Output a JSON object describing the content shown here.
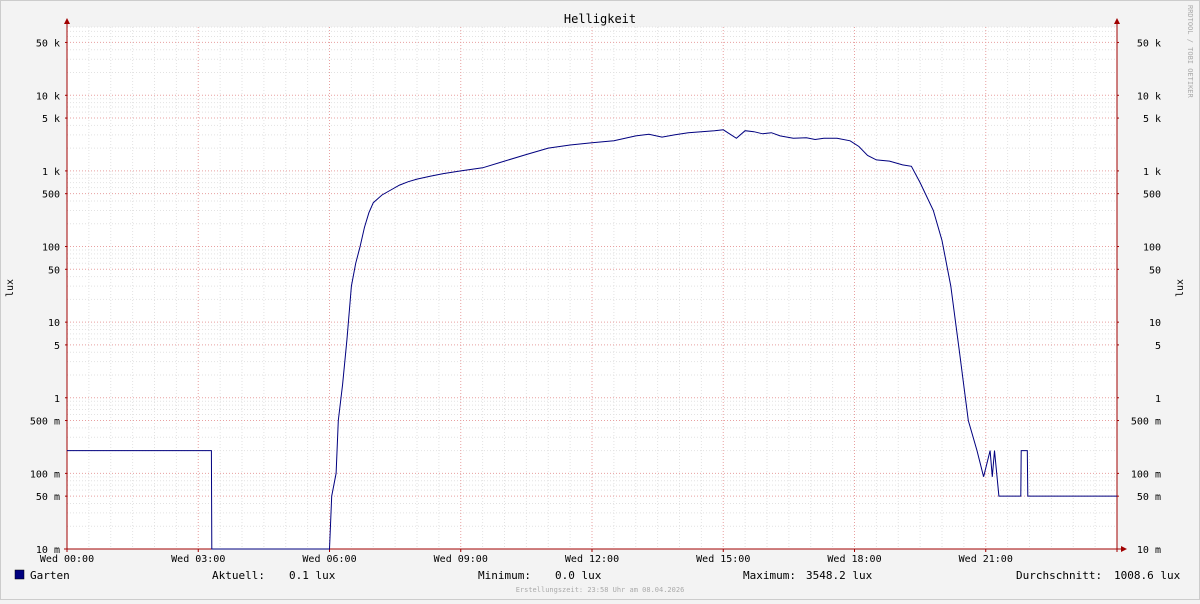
{
  "chart_data": {
    "type": "line",
    "title": "Helligkeit",
    "ylabel": "lux",
    "yscale": "log",
    "ylim": [
      0.01,
      80000
    ],
    "xlim": [
      0,
      24
    ],
    "x_ticks": [
      {
        "x": 0,
        "label": "Wed 00:00"
      },
      {
        "x": 3,
        "label": "Wed 03:00"
      },
      {
        "x": 6,
        "label": "Wed 06:00"
      },
      {
        "x": 9,
        "label": "Wed 09:00"
      },
      {
        "x": 12,
        "label": "Wed 12:00"
      },
      {
        "x": 15,
        "label": "Wed 15:00"
      },
      {
        "x": 18,
        "label": "Wed 18:00"
      },
      {
        "x": 21,
        "label": "Wed 21:00"
      }
    ],
    "y_ticks": [
      {
        "y": 0.01,
        "label": "10 m"
      },
      {
        "y": 0.05,
        "label": "50 m"
      },
      {
        "y": 0.1,
        "label": "100 m"
      },
      {
        "y": 0.5,
        "label": "500 m"
      },
      {
        "y": 1,
        "label": "1"
      },
      {
        "y": 5,
        "label": "5"
      },
      {
        "y": 10,
        "label": "10"
      },
      {
        "y": 50,
        "label": "50"
      },
      {
        "y": 100,
        "label": "100"
      },
      {
        "y": 500,
        "label": "500"
      },
      {
        "y": 1000,
        "label": "1 k"
      },
      {
        "y": 5000,
        "label": "5 k"
      },
      {
        "y": 10000,
        "label": "10 k"
      },
      {
        "y": 50000,
        "label": "50 k"
      }
    ],
    "grid": true,
    "series": [
      {
        "name": "Garten",
        "color": "#00007f",
        "x": [
          0,
          3.3,
          3.31,
          6.0,
          6.05,
          6.15,
          6.2,
          6.3,
          6.4,
          6.5,
          6.6,
          6.7,
          6.8,
          6.9,
          7.0,
          7.2,
          7.4,
          7.6,
          7.8,
          8.0,
          8.3,
          8.6,
          9.0,
          9.5,
          10.0,
          10.5,
          11.0,
          11.5,
          12.0,
          12.5,
          13.0,
          13.3,
          13.6,
          13.9,
          14.2,
          14.5,
          14.8,
          15.0,
          15.3,
          15.5,
          15.7,
          15.9,
          16.1,
          16.3,
          16.6,
          16.9,
          17.1,
          17.3,
          17.6,
          17.9,
          18.1,
          18.3,
          18.5,
          18.8,
          19.1,
          19.3,
          19.5,
          19.8,
          20.0,
          20.2,
          20.4,
          20.6,
          20.8,
          20.95,
          21.1,
          21.15,
          21.2,
          21.3,
          21.31,
          21.8,
          21.81,
          21.95,
          21.96,
          22.1,
          22.11,
          24.0
        ],
        "values": [
          0.2,
          0.2,
          0.01,
          0.01,
          0.05,
          0.1,
          0.5,
          1.5,
          6,
          30,
          60,
          100,
          180,
          280,
          380,
          480,
          560,
          650,
          720,
          780,
          850,
          920,
          1000,
          1100,
          1350,
          1650,
          2000,
          2200,
          2350,
          2500,
          2900,
          3050,
          2800,
          3000,
          3200,
          3300,
          3400,
          3500,
          2700,
          3400,
          3300,
          3100,
          3200,
          2900,
          2700,
          2750,
          2600,
          2700,
          2700,
          2500,
          2100,
          1600,
          1400,
          1350,
          1200,
          1150,
          700,
          300,
          120,
          30,
          4,
          0.5,
          0.2,
          0.09,
          0.2,
          0.09,
          0.2,
          0.05,
          0.05,
          0.05,
          0.2,
          0.2,
          0.05,
          0.05,
          0.05,
          0.05
        ]
      }
    ],
    "legend": {
      "position": "bottom",
      "entries": [
        {
          "label": "Garten",
          "color": "#00007f"
        }
      ]
    },
    "stats": [
      {
        "label": "Aktuell:",
        "value": "0.1 lux"
      },
      {
        "label": "Minimum:",
        "value": "0.0 lux"
      },
      {
        "label": "Maximum:",
        "value": "3548.2 lux"
      },
      {
        "label": "Durchschnitt:",
        "value": "1008.6 lux"
      }
    ],
    "watermark": "RRDTOOL / TOBI OETIKER",
    "footer": "Erstellungszeit: 23:58 Uhr am 08.04.2026"
  }
}
